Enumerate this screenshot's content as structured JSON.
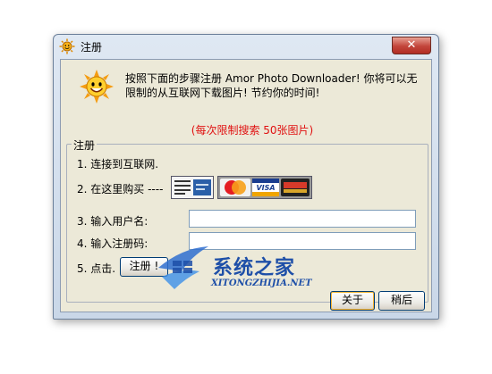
{
  "window": {
    "title": "注册",
    "close_glyph": "✕"
  },
  "intro_text": "按照下面的步骤注册 Amor Photo Downloader! 你将可以无限制的从互联网下载图片! 节约你的时间!",
  "limit_text": "(每次限制搜索 50张图片)",
  "group": {
    "label": "注册",
    "steps": [
      {
        "label": "1. 连接到互联网."
      },
      {
        "label": "2. 在这里购买 ----"
      },
      {
        "label": "3. 输入用户名:"
      },
      {
        "label": "4. 输入注册码:"
      },
      {
        "label": "5. 点击."
      }
    ],
    "username_value": "",
    "code_value": "",
    "register_button": "注册 !"
  },
  "payment_badges": [
    {
      "name": "paypal-badge"
    },
    {
      "name": "mastercard-badge"
    },
    {
      "name": "visa-badge"
    },
    {
      "name": "discover-badge"
    }
  ],
  "buttons": {
    "about": "关于",
    "later": "稍后"
  },
  "watermark": {
    "text": "系统之家",
    "url": "XITONGZHIJIA.NET"
  },
  "colors": {
    "limit": "#e01010",
    "watermark": "#1e4fa8",
    "dialog_bg": "#ece9d8"
  }
}
